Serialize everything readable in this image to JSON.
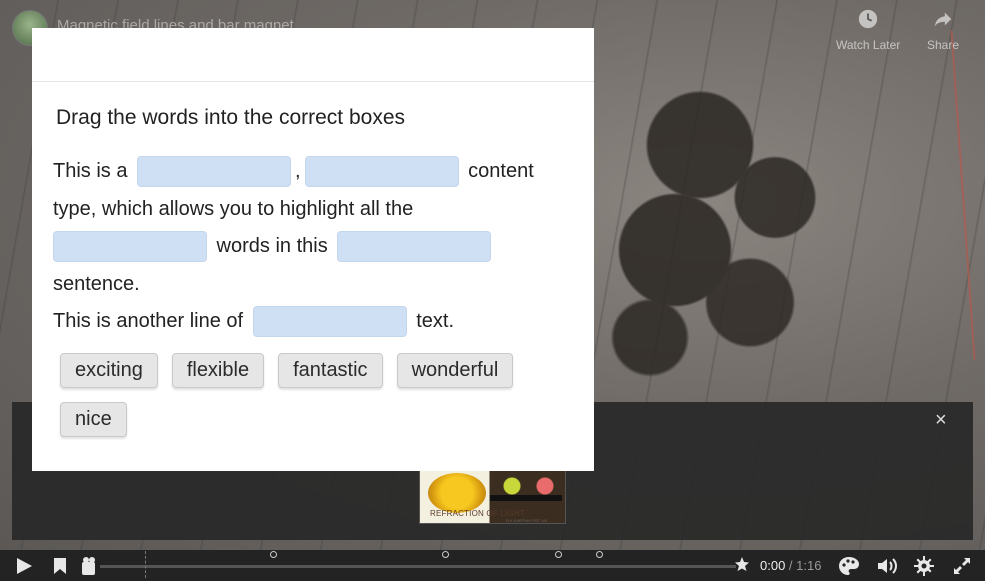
{
  "video": {
    "title": "Magnetic field lines and bar magnet",
    "watch_later_label": "Watch Later",
    "share_label": "Share",
    "current_time": "0:00",
    "separator": " / ",
    "duration": "1:16"
  },
  "end_screen": {
    "close_glyph": "×",
    "thumbnail_caption": "REFRACTION  OF LIGHT",
    "thumbnail_small_text": "R.K.KARTHIK PST 1/A"
  },
  "dialog": {
    "instructions": "Drag the words into the correct boxes",
    "sentence": {
      "t1": "This is a ",
      "t2": ",",
      "t3": " content type, which allows you to highlight all the ",
      "t4": " words in this ",
      "t5": " sentence.",
      "t6": "This is another line of ",
      "t7": " text."
    },
    "words": [
      "exciting",
      "flexible",
      "fantastic",
      "wonderful",
      "nice"
    ]
  }
}
